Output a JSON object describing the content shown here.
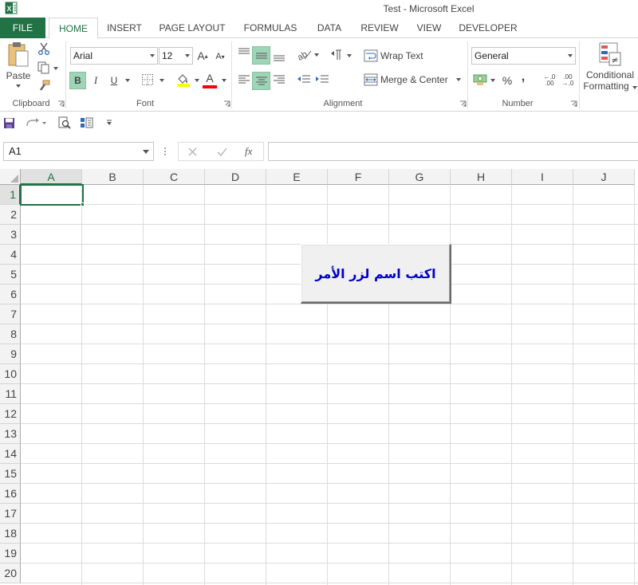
{
  "window": {
    "title": "Test - Microsoft Excel"
  },
  "tabs": [
    {
      "label": "FILE"
    },
    {
      "label": "HOME"
    },
    {
      "label": "INSERT"
    },
    {
      "label": "PAGE LAYOUT"
    },
    {
      "label": "FORMULAS"
    },
    {
      "label": "DATA"
    },
    {
      "label": "REVIEW"
    },
    {
      "label": "VIEW"
    },
    {
      "label": "DEVELOPER"
    }
  ],
  "clipboard": {
    "paste_label": "Paste",
    "group_label": "Clipboard"
  },
  "font": {
    "name": "Arial",
    "size": "12",
    "bold": "B",
    "italic": "I",
    "underline": "U",
    "grow": "A",
    "shrink": "A",
    "color_letter": "A",
    "group_label": "Font",
    "color_accent": "#ff0000",
    "fill_accent": "#ffff00"
  },
  "alignment": {
    "wrap_text": "Wrap Text",
    "merge_center": "Merge & Center",
    "group_label": "Alignment"
  },
  "number": {
    "format": "General",
    "percent": "%",
    "comma": ",",
    "inc_decimal_top": "←.0",
    "inc_decimal_bottom": ".00",
    "dec_decimal_top": ".00",
    "dec_decimal_bottom": "→.0",
    "group_label": "Number"
  },
  "styles": {
    "conditional_line1": "Conditional",
    "conditional_line2": "Formatting"
  },
  "formula_bar": {
    "name_box": "A1",
    "fx": "fx",
    "value": ""
  },
  "sheet": {
    "columns": [
      "A",
      "B",
      "C",
      "D",
      "E",
      "F",
      "G",
      "H",
      "I",
      "J"
    ],
    "rows": [
      "1",
      "2",
      "3",
      "4",
      "5",
      "6",
      "7",
      "8",
      "9",
      "10",
      "11",
      "12",
      "13",
      "14",
      "15",
      "16",
      "17",
      "18",
      "19",
      "20"
    ],
    "active_cell": "A1",
    "command_button_label": "اكتب اسم لزر الأمر"
  },
  "colors": {
    "accent": "#217346",
    "button_text": "#0000cc"
  }
}
